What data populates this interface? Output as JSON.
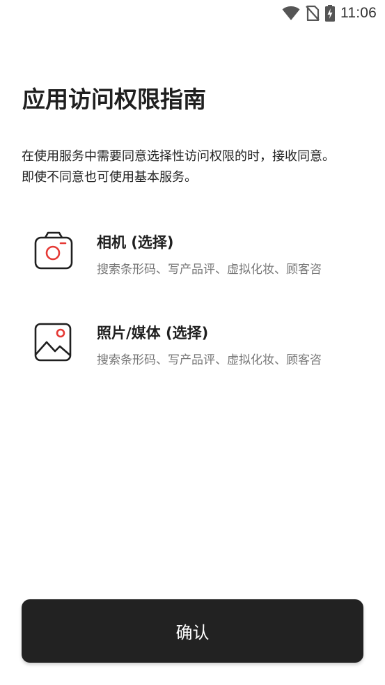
{
  "status_bar": {
    "time": "11:06",
    "icons": [
      "wifi-icon",
      "no-sim-icon",
      "battery-charging-icon"
    ]
  },
  "page": {
    "title": "应用访问权限指南",
    "description": "在使用服务中需要同意选择性访问权限的时，接收同意。 即使不同意也可使用基本服务。"
  },
  "permissions": [
    {
      "icon": "camera-icon",
      "title": "相机 (选择)",
      "description": "搜索条形码、写产品评、虚拟化妆、顾客咨"
    },
    {
      "icon": "image-icon",
      "title": "照片/媒体 (选择)",
      "description": "搜索条形码、写产品评、虚拟化妆、顾客咨"
    }
  ],
  "confirm_button": {
    "label": "确认"
  },
  "colors": {
    "accent": "#e53935",
    "button_bg": "#222222",
    "text_primary": "#1f1f1f",
    "text_secondary": "#777777"
  }
}
